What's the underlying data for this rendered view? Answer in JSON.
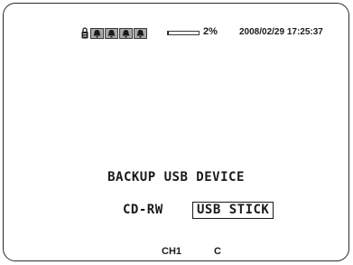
{
  "status_bar": {
    "icons": [
      "lock-icon",
      "alarm-bell-icon",
      "alarm-bell-icon",
      "alarm-bell-icon",
      "alarm-bell-icon"
    ],
    "disk_usage": 0.02,
    "disk_usage_label": "2%",
    "datetime": "2008/02/29 17:25:37"
  },
  "menu": {
    "title": "BACKUP USB DEVICE",
    "options": [
      "CD-RW",
      "USB STICK"
    ],
    "selected": "USB STICK"
  },
  "footer": {
    "channel": "CH1",
    "mode": "C"
  },
  "colors": {
    "background": "#ffffff",
    "text": "#1a1a1a",
    "indicator_fill": "#a8a8a8"
  }
}
